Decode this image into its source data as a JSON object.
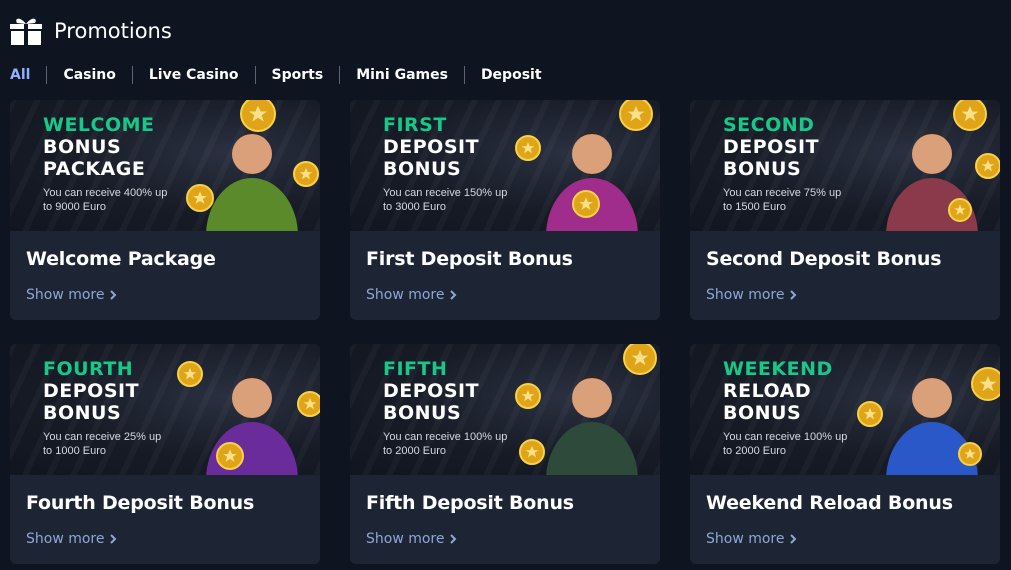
{
  "header": {
    "title": "Promotions",
    "icon": "gift-icon"
  },
  "tabs": [
    {
      "label": "All",
      "active": true
    },
    {
      "label": "Casino",
      "active": false
    },
    {
      "label": "Live Casino",
      "active": false
    },
    {
      "label": "Sports",
      "active": false
    },
    {
      "label": "Mini Games",
      "active": false
    },
    {
      "label": "Deposit",
      "active": false
    }
  ],
  "colors": {
    "accent_tab": "#8fb0ff",
    "banner_green": "#17c989",
    "card_bg": "#1d2433",
    "page_bg": "#0f1421",
    "link": "#8fa6d8"
  },
  "cards": [
    {
      "banner_line1": "WELCOME",
      "banner_line2": "BONUS",
      "banner_line3": "PACKAGE",
      "banner_sub": "You can receive 400% up to 9000 Euro",
      "title": "Welcome Package",
      "link": "Show more",
      "character": "archer",
      "char_color": "#5a8a2a"
    },
    {
      "banner_line1": "FIRST",
      "banner_line2": "DEPOSIT",
      "banner_line3": "BONUS",
      "banner_sub": "You can receive 150% up to 3000 Euro",
      "title": "First Deposit Bonus",
      "link": "Show more",
      "character": "gorilla",
      "char_color": "#a02c8c"
    },
    {
      "banner_line1": "SECOND",
      "banner_line2": "DEPOSIT",
      "banner_line3": "BONUS",
      "banner_sub": "You can receive 75% up to 1500 Euro",
      "title": "Second Deposit Bonus",
      "link": "Show more",
      "character": "woman",
      "char_color": "#8a3a4a"
    },
    {
      "banner_line1": "FOURTH",
      "banner_line2": "DEPOSIT",
      "banner_line3": "BONUS",
      "banner_sub": "You can receive 25% up to 1000 Euro",
      "title": "Fourth Deposit Bonus",
      "link": "Show more",
      "character": "redhead",
      "char_color": "#6a2c9a"
    },
    {
      "banner_line1": "FIFTH",
      "banner_line2": "DEPOSIT",
      "banner_line3": "BONUS",
      "banner_sub": "You can receive 100% up to 2000 Euro",
      "title": "Fifth Deposit Bonus",
      "link": "Show more",
      "character": "old-man",
      "char_color": "#2e4a3a"
    },
    {
      "banner_line1": "WEEKEND",
      "banner_line2": "RELOAD",
      "banner_line3": "BONUS",
      "banner_sub": "You can receive 100% up to 2000 Euro",
      "title": "Weekend Reload Bonus",
      "link": "Show more",
      "character": "jester",
      "char_color": "#2a58c8"
    }
  ]
}
